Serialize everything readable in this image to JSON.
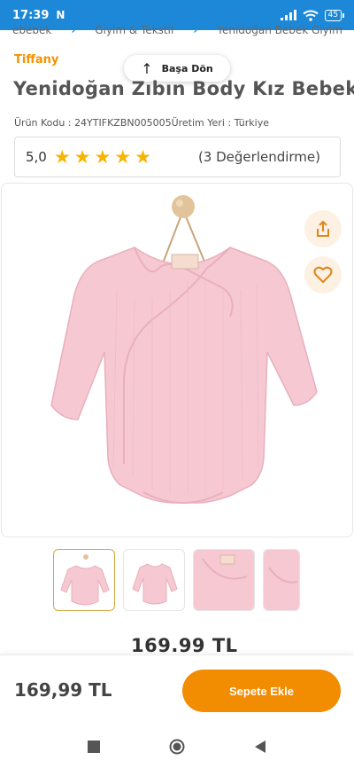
{
  "status_bar": {
    "time": "17:39",
    "notification_icon": "N",
    "battery": "45"
  },
  "breadcrumb": [
    "ebebek",
    "Giyim & Tekstil",
    "Yenidoğan Bebek Giyim"
  ],
  "product": {
    "brand": "Tiffany",
    "title": "Yenidoğan Zıbın Body Kız Bebek",
    "code_line": "Ürün Kodu : 24YTIFKZBN005005Üretim Yeri : Türkiye",
    "rating": "5,0",
    "stars": 5,
    "review_count": "(3 Değerlendirme)",
    "price_mid": "169.99 TL",
    "price": "169,99 TL"
  },
  "actions": {
    "back_to_top": "Başa Dön",
    "add_to_cart": "Sepete Ekle"
  },
  "icons": {
    "share": "share-icon",
    "favorite": "heart-icon",
    "back_arrow": "arrow-up-icon"
  },
  "colors": {
    "status_bar": "#1e88d8",
    "brand": "#f39200",
    "star": "#f7b500",
    "cart_button": "#f28c00",
    "product_pink": "#f6c9d2"
  }
}
